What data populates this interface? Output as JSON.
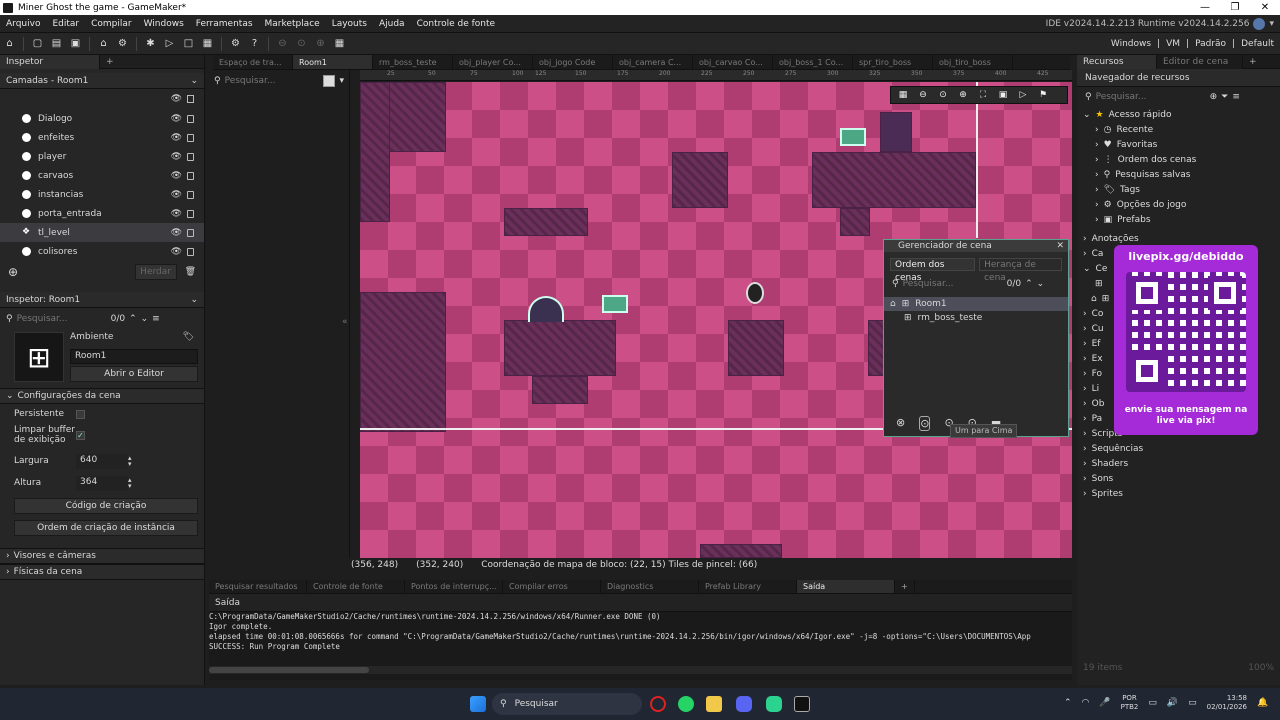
{
  "window": {
    "title": "Miner Ghost the game - GameMaker*",
    "controls": [
      "—",
      "❐",
      "✕"
    ]
  },
  "menu": [
    "Arquivo",
    "Editar",
    "Compilar",
    "Windows",
    "Ferramentas",
    "Marketplace",
    "Layouts",
    "Ajuda",
    "Controle de fonte"
  ],
  "version": "IDE v2024.14.2.213  Runtime v2024.14.2.256",
  "toolbar_right": [
    "Windows",
    "|",
    "VM",
    "|",
    "Padrão",
    "|",
    "Default"
  ],
  "left": {
    "tab": "Inspetor",
    "layers_title": "Camadas - Room1",
    "layers": [
      "Dialogo",
      "enfeites",
      "player",
      "carvaos",
      "instancias",
      "porta_entrada",
      "tl_level",
      "colisores"
    ],
    "selected_layer": "tl_level",
    "inherit": "Herdar",
    "inspector_title": "Inspetor: Room1",
    "search_placeholder": "Pesquisar...",
    "search_count": "0/0",
    "ambient_label": "Ambiente",
    "room_name": "Room1",
    "open_editor": "Abrir o Editor",
    "room_settings": "Configurações da cena",
    "persistent": "Persistente",
    "clear_buffer": "Limpar buffer\nde exibição",
    "width_label": "Largura",
    "width_value": "640",
    "height_label": "Altura",
    "height_value": "364",
    "creation_code": "Código de criação",
    "instance_order": "Ordem de criação de instância",
    "views": "Visores e câmeras",
    "physics": "Físicas da cena"
  },
  "mid": {
    "search_placeholder": "Pesquisar..."
  },
  "doc_tabs": [
    "Espaço de tra...",
    "Room1",
    "rm_boss_teste",
    "obj_player Co...",
    "obj_jogo Code",
    "obj_camera C...",
    "obj_carvao Co...",
    "obj_boss_1 Co...",
    "spr_tiro_boss",
    "obj_tiro_boss"
  ],
  "active_doc_tab": "Room1",
  "ruler_ticks": [
    "25",
    "50",
    "75",
    "100",
    "125",
    "150",
    "175",
    "200",
    "225",
    "250",
    "275",
    "300",
    "325",
    "350",
    "375",
    "400",
    "425"
  ],
  "canvas_status": {
    "a": "(356, 248)",
    "b": "(352, 240)",
    "c": "Coordenação de mapa de bloco: (22, 15) Tiles de pincel: (66)"
  },
  "scene_manager": {
    "title": "Gerenciador de cena",
    "tab_order": "Ordem dos cenas",
    "tab_inherit": "Herança de cena",
    "search_placeholder": "Pesquisar...",
    "count": "0/0",
    "rooms": [
      "Room1",
      "rm_boss_teste"
    ],
    "tooltip": "Um para Cima"
  },
  "right": {
    "tab1": "Recursos",
    "tab2": "Editor de cena",
    "browser": "Navegador de recursos",
    "search_placeholder": "Pesquisar...",
    "quick_access": "Acesso rápido",
    "quick_items": [
      "Recente",
      "Favoritas",
      "Ordem dos cenas",
      "Pesquisas salvas",
      "Tags",
      "Opções do jogo",
      "Prefabs"
    ],
    "folders_partial": [
      "Anotações",
      "Ca",
      "Ce",
      "Co",
      "Cu",
      "Ef",
      "Ex",
      "Fo",
      "Li",
      "Ob",
      "Pa"
    ],
    "folders": [
      "Scripts",
      "Sequências",
      "Shaders",
      "Sons",
      "Sprites"
    ],
    "status_left": "19 items",
    "status_right": "100%"
  },
  "output_tabs": [
    "Pesquisar resultados",
    "Controle de fonte",
    "Pontos de interrupç...",
    "Compilar erros",
    "Diagnostics",
    "Prefab Library",
    "Saída"
  ],
  "active_output_tab": "Saída",
  "output_title": "Saída",
  "output_lines": [
    "C:\\ProgramData/GameMakerStudio2/Cache/runtimes\\runtime-2024.14.2.256/windows/x64/Runner.exe DONE (0)",
    "Igor complete.",
    "elapsed time 00:01:08.0065666s for command \"C:\\ProgramData/GameMakerStudio2/Cache/runtimes\\runtime-2024.14.2.256/bin/igor/windows/x64/Igor.exe\" -j=8  -options=\"C:\\Users\\DOCUMENTOS\\App",
    "SUCCESS: Run Program Complete"
  ],
  "taskbar": {
    "search": "Pesquisar",
    "lang": "POR",
    "layout": "PTB2",
    "time": "13:58",
    "date": "02/01/2026"
  },
  "promo": {
    "url": "livepix.gg/debiddo",
    "message": "envie sua mensagem na\nlive via pix!"
  },
  "colors": {
    "accent": "#5aa38c",
    "canvas_a": "#cc4f87",
    "canvas_b": "#b03d72",
    "promo": "#a52ad8"
  }
}
